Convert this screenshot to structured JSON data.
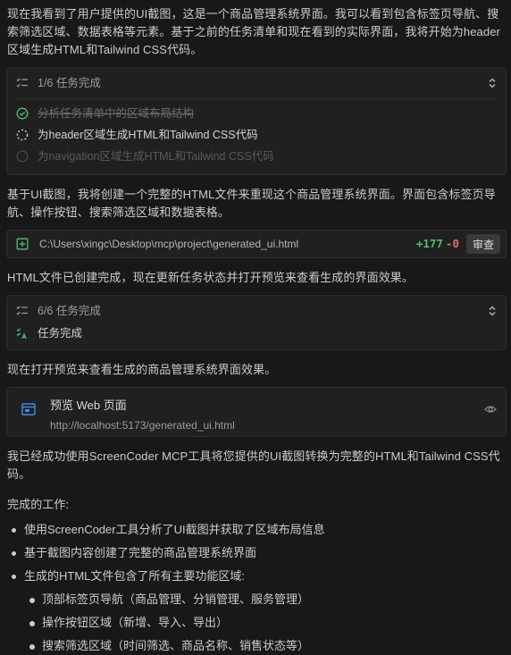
{
  "intro_text": "现在我看到了用户提供的UI截图，这是一个商品管理系统界面。我可以看到包含标签页导航、搜索筛选区域、数据表格等元素。基于之前的任务清单和现在看到的实际界面，我将开始为header区域生成HTML和Tailwind CSS代码。",
  "task_card_1": {
    "progress": "1/6 任务完成",
    "items": [
      {
        "label": "分析任务清单中的区域布局结构",
        "state": "done"
      },
      {
        "label": "为header区域生成HTML和Tailwind CSS代码",
        "state": "active"
      },
      {
        "label": "为navigation区域生成HTML和Tailwind CSS代码",
        "state": "pending"
      }
    ]
  },
  "text_2": "基于UI截图，我将创建一个完整的HTML文件来重现这个商品管理系统界面。界面包含标签页导航、操作按钮、搜索筛选区域和数据表格。",
  "file_card": {
    "path": "C:\\Users\\xingc\\Desktop\\mcp\\project\\generated_ui.html",
    "added": "+177",
    "removed": "-0",
    "review_label": "审查"
  },
  "text_3": "HTML文件已创建完成，现在更新任务状态并打开预览来查看生成的界面效果。",
  "task_card_2": {
    "progress": "6/6 任务完成",
    "status": "任务完成"
  },
  "text_4": "现在打开预览来查看生成的商品管理系统界面效果。",
  "preview_card": {
    "title": "预览 Web 页面",
    "url": "http://localhost:5173/generated_ui.html"
  },
  "text_5": "我已经成功使用ScreenCoder MCP工具将您提供的UI截图转换为完整的HTML和Tailwind CSS代码。",
  "done_heading": "完成的工作:",
  "bullets": [
    "使用ScreenCoder工具分析了UI截图并获取了区域布局信息",
    "基于截图内容创建了完整的商品管理系统界面",
    "生成的HTML文件包含了所有主要功能区域:"
  ],
  "sub_bullets": [
    "顶部标签页导航（商品管理、分销管理、服务管理）",
    "操作按钮区域（新增、导入、导出）",
    "搜索筛选区域（时间筛选、商品名称、销售状态等）"
  ],
  "colors": {
    "background": "#181818",
    "card": "#202020",
    "added": "#4ec06e",
    "removed": "#e06c6c",
    "accent_blue": "#3b8eea"
  },
  "icons": {
    "task_list": "checklist-icon",
    "chevron": "chevron-up-down-icon",
    "done": "check-circle-icon",
    "active": "spinner-icon",
    "pending": "circle-icon",
    "file": "file-add-icon",
    "browser": "browser-window-icon",
    "eye": "eye-icon",
    "complete": "tasks-complete-icon"
  }
}
